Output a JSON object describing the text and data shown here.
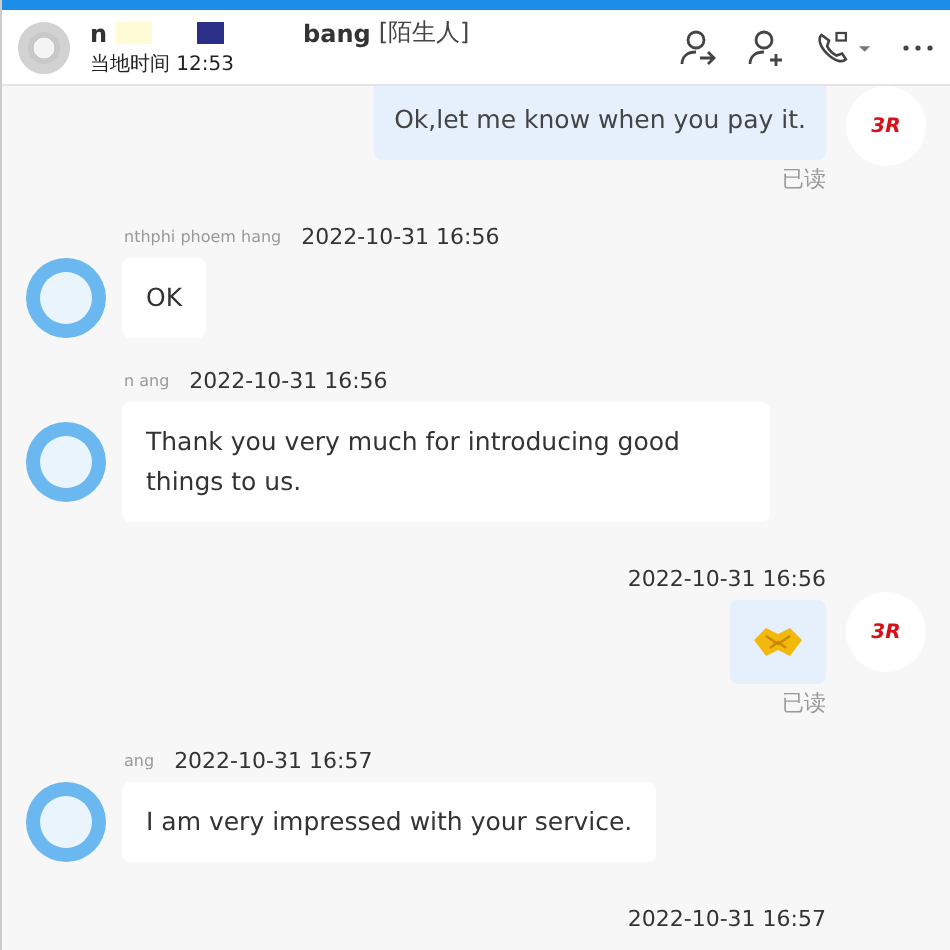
{
  "header": {
    "name_start": "n",
    "name_end": "bang",
    "tag": "[陌生人]",
    "local_time": "当地时间 12:53"
  },
  "messages": [
    {
      "kind": "out",
      "text": "Ok,let me know when you pay it.",
      "status": "已读",
      "avatar": "3R"
    },
    {
      "kind": "in",
      "sender": "nthphi phoem hang",
      "time": "2022-10-31 16:56",
      "text": "OK"
    },
    {
      "kind": "in",
      "sender": "n ang",
      "time": "2022-10-31 16:56",
      "text": "Thank you very much for introducing good things to us."
    },
    {
      "kind": "timestamp",
      "text": "2022-10-31 16:56"
    },
    {
      "kind": "sticker",
      "status": "已读",
      "avatar": "3R"
    },
    {
      "kind": "in",
      "sender": "ang",
      "time": "2022-10-31 16:57",
      "text": "I am very impressed with your service."
    },
    {
      "kind": "timestamp",
      "text": "2022-10-31 16:57"
    }
  ]
}
